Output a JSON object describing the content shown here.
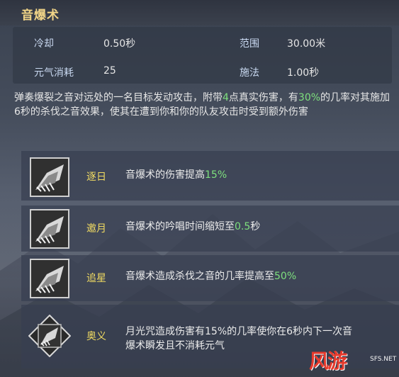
{
  "skill": {
    "title": "音爆术",
    "stats": [
      {
        "label": "冷却",
        "value": "0.50秒"
      },
      {
        "label": "范围",
        "value": "30.00米"
      },
      {
        "label": "元气消耗",
        "value": "25"
      },
      {
        "label": "施法",
        "value": "1.00秒"
      }
    ],
    "description": {
      "p1": "弹奏爆裂之音对远处的一名目标发动攻击，附带",
      "h1": "4",
      "p2": "点真实伤害，有",
      "h2": "30%",
      "p3": "的几率对其施加6秒的杀伐之音效果，使其在遭到你和你的队友攻击时受到额外伤害"
    }
  },
  "talents": [
    {
      "name": "逐日",
      "text": "音爆术的伤害提高",
      "highlight": "15%",
      "suffix": "",
      "icon": "sonic-burst-icon"
    },
    {
      "name": "邀月",
      "text": "音爆术的吟唱时间缩短至",
      "highlight": "0.5",
      "suffix": "秒",
      "icon": "sonic-burst-icon"
    },
    {
      "name": "追星",
      "text": "音爆术造成杀伐之音的几率提高至",
      "highlight": "50%",
      "suffix": "",
      "icon": "sonic-burst-icon"
    },
    {
      "name": "奥义",
      "text_line1": "月光咒造成伤害有15%的几率使你在6秒内下一次音",
      "text_line2": "爆术瞬发且不消耗元气",
      "icon": "sonic-burst-icon"
    }
  ],
  "watermark": {
    "main": "风游",
    "sub": "SFS.NET"
  },
  "colors": {
    "title": "#f0d487",
    "talent_name": "#f2dc62",
    "highlight": "#7ee07e",
    "stat_label": "#c8d8f0"
  }
}
